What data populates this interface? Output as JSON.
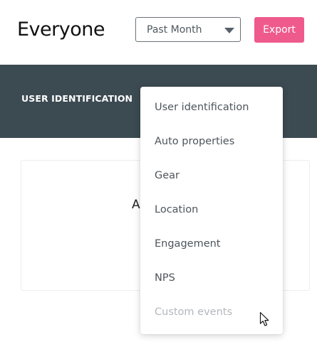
{
  "header": {
    "title": "Everyone",
    "period_select": {
      "value": "Past Month"
    },
    "export_label": "Export"
  },
  "nav": {
    "active_tab": "USER IDENTIFICATION"
  },
  "card": {
    "partial_text": "Ac"
  },
  "dropdown": {
    "items": [
      {
        "label": "User identification",
        "enabled": true
      },
      {
        "label": "Auto properties",
        "enabled": true
      },
      {
        "label": "Gear",
        "enabled": true
      },
      {
        "label": "Location",
        "enabled": true
      },
      {
        "label": "Engagement",
        "enabled": true
      },
      {
        "label": "NPS",
        "enabled": true
      },
      {
        "label": "Custom events",
        "enabled": false
      }
    ]
  },
  "colors": {
    "accent_pink": "#ef5a8c",
    "dark_band": "#3c4a52",
    "disabled_text": "#b3b8bc"
  },
  "icons": {
    "select_caret": "caret-down-icon",
    "pointer": "mouse-cursor-icon"
  }
}
